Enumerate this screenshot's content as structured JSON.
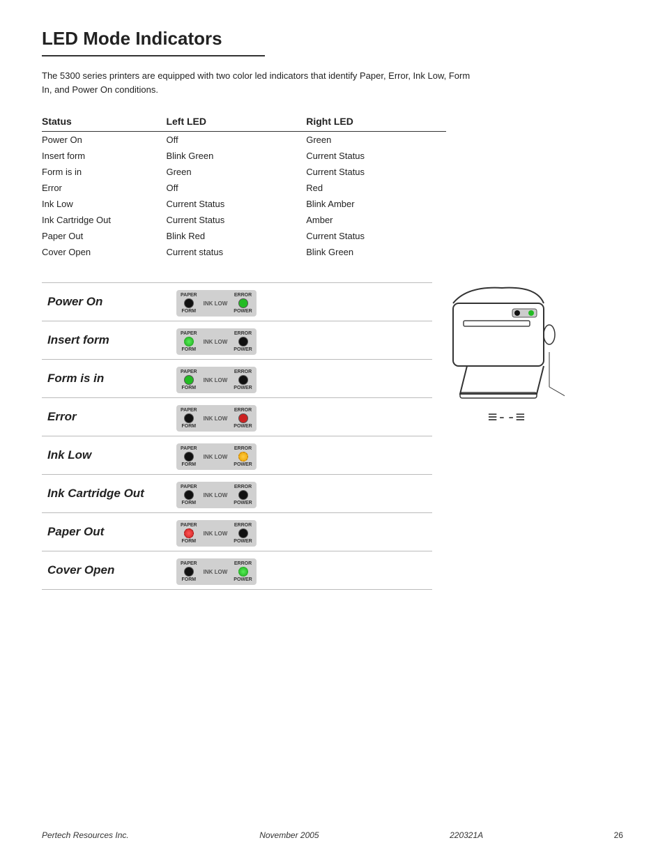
{
  "page": {
    "title": "LED Mode Indicators",
    "intro": "The 5300 series printers are equipped with two color led indicators that identify Paper, Error, Ink Low, Form In, and Power On conditions.",
    "table": {
      "headers": [
        "Status",
        "Left LED",
        "Right LED"
      ],
      "rows": [
        [
          "Power On",
          "Off",
          "Green"
        ],
        [
          "Insert form",
          "Blink Green",
          "Current Status"
        ],
        [
          "Form is in",
          "Green",
          "Current Status"
        ],
        [
          "Error",
          "Off",
          "Red"
        ],
        [
          "Ink Low",
          "Current Status",
          "Blink Amber"
        ],
        [
          "Ink Cartridge Out",
          "Current Status",
          "Amber"
        ],
        [
          "Paper Out",
          "Blink Red",
          "Current Status"
        ],
        [
          "Cover Open",
          "Current status",
          "Blink Green"
        ]
      ]
    },
    "diagram": {
      "rows": [
        {
          "label": "Power On",
          "left_led": "black",
          "right_led": "green"
        },
        {
          "label": "Insert form",
          "left_led": "blink-green",
          "right_led": "black"
        },
        {
          "label": "Form is in",
          "left_led": "green",
          "right_led": "black"
        },
        {
          "label": "Error",
          "left_led": "black",
          "right_led": "red"
        },
        {
          "label": "Ink Low",
          "left_led": "black",
          "right_led": "blink-amber"
        },
        {
          "label": "Ink Cartridge Out",
          "left_led": "black",
          "right_led": "black"
        },
        {
          "label": "Paper Out",
          "left_led": "blink-red",
          "right_led": "black"
        },
        {
          "label": "Cover Open",
          "left_led": "black",
          "right_led": "blink-green"
        }
      ]
    },
    "footer": {
      "left": "Pertech Resources Inc.",
      "center": "November  2005",
      "right": "220321A",
      "page": "26"
    }
  }
}
